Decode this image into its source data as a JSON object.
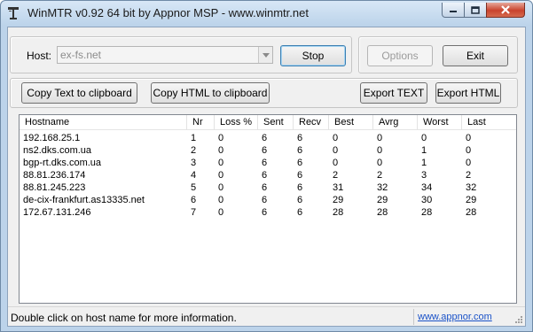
{
  "window": {
    "title": "WinMTR v0.92 64 bit by Appnor MSP - www.winmtr.net",
    "app_icon": "network-tower-icon"
  },
  "controls": {
    "host_label": "Host:",
    "host_value": "ex-fs.net",
    "stop_label": "Stop",
    "options_label": "Options",
    "exit_label": "Exit",
    "copy_text_label": "Copy Text to clipboard",
    "copy_html_label": "Copy HTML to clipboard",
    "export_text_label": "Export TEXT",
    "export_html_label": "Export HTML"
  },
  "table": {
    "headers": [
      "Hostname",
      "Nr",
      "Loss %",
      "Sent",
      "Recv",
      "Best",
      "Avrg",
      "Worst",
      "Last"
    ],
    "rows": [
      [
        "192.168.25.1",
        "1",
        "0",
        "6",
        "6",
        "0",
        "0",
        "0",
        "0"
      ],
      [
        "ns2.dks.com.ua",
        "2",
        "0",
        "6",
        "6",
        "0",
        "0",
        "1",
        "0"
      ],
      [
        "bgp-rt.dks.com.ua",
        "3",
        "0",
        "6",
        "6",
        "0",
        "0",
        "1",
        "0"
      ],
      [
        "88.81.236.174",
        "4",
        "0",
        "6",
        "6",
        "2",
        "2",
        "3",
        "2"
      ],
      [
        "88.81.245.223",
        "5",
        "0",
        "6",
        "6",
        "31",
        "32",
        "34",
        "32"
      ],
      [
        "de-cix-frankfurt.as13335.net",
        "6",
        "0",
        "6",
        "6",
        "29",
        "29",
        "30",
        "29"
      ],
      [
        "172.67.131.246",
        "7",
        "0",
        "6",
        "6",
        "28",
        "28",
        "28",
        "28"
      ]
    ]
  },
  "status": {
    "message": "Double click on host name for more information.",
    "link": "www.appnor.com"
  }
}
